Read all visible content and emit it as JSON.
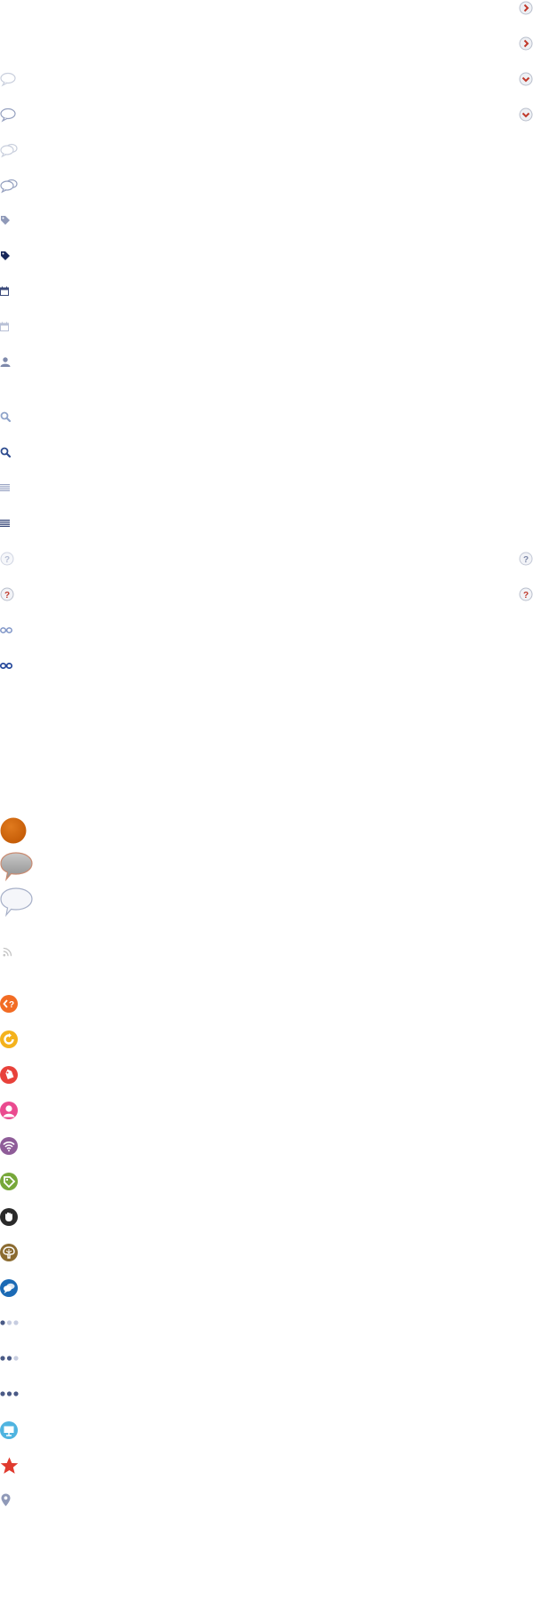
{
  "sheet": {
    "title": "",
    "colors": {
      "chevron_red": "#c0392b",
      "icon_pale": "#a9b3cf",
      "icon_dark": "#3b4a7a",
      "icon_navy": "#17275a",
      "search_dark": "#2c4a8e",
      "orange_disc": "#d0640a",
      "tile_orange": "#f26c24",
      "tile_yellow": "#f4b21c",
      "tile_red": "#e8413a",
      "tile_pink": "#ea4a8f",
      "tile_purple": "#8e5c98",
      "tile_green": "#77a83a",
      "tile_black": "#2a2a2a",
      "tile_brown": "#8b6b30",
      "tile_blue": "#1b6ab5",
      "tile_sky": "#4fb4e0",
      "star_red": "#e03a2e",
      "pin_gray": "#8f99b8"
    },
    "right_icons": [
      "chevron-right-button-icon",
      "chevron-right-button-icon",
      "chevron-down-button-icon",
      "chevron-down-button-icon",
      "help-button-pale-icon",
      "help-button-icon"
    ],
    "left_icons": [
      "comment-bubble-pale-icon",
      "comment-bubble-icon",
      "comments-pale-icon",
      "comments-icon",
      "tag-icon",
      "tag-dark-icon",
      "calendar-icon",
      "calendar-pale-icon",
      "person-icon",
      "search-pale-icon",
      "search-icon",
      "list-lines-pale-icon",
      "list-lines-icon",
      "help-circle-pale-icon",
      "help-circle-icon",
      "infinity-pale-icon",
      "infinity-icon",
      "orange-disc-icon",
      "speech-bubble-gray-icon",
      "speech-bubble-white-icon",
      "rss-icon",
      "code-tile-icon",
      "refresh-tile-icon",
      "tag-tile-icon",
      "user-tile-icon",
      "wifi-tile-icon",
      "tag-green-tile-icon",
      "hand-tile-icon",
      "tree-tile-icon",
      "chat-tile-icon",
      "pager-1-of-3-icon",
      "pager-2-of-3-icon",
      "pager-3-of-3-icon",
      "presentation-tile-icon",
      "star-icon",
      "map-pin-icon"
    ]
  }
}
